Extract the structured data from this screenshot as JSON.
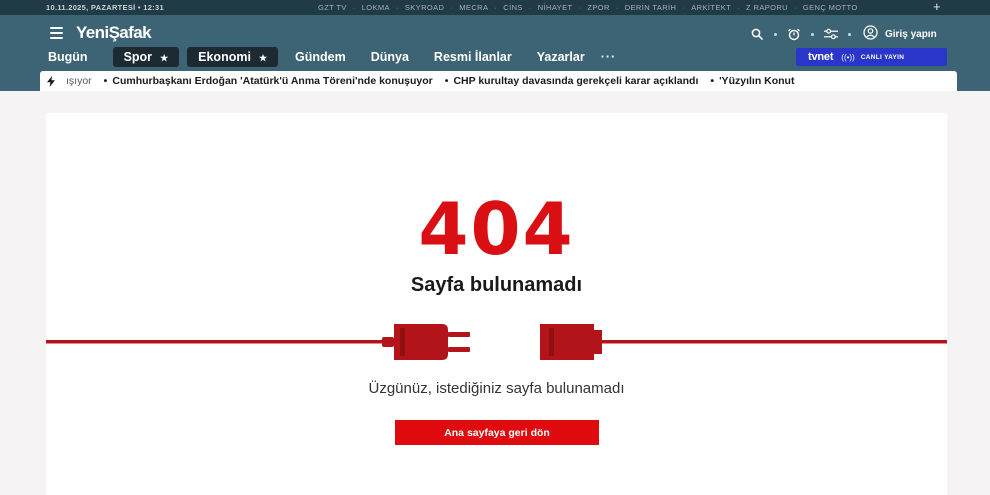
{
  "topbar": {
    "date": "10.11.2025, PAZARTESİ  •  12:31",
    "links": [
      "GZT TV",
      "LOKMA",
      "SKYROAD",
      "MECRA",
      "CİNS",
      "NİHAYET",
      "ZPOR",
      "DERİN TARİH",
      "ARKİTEKT",
      "Z RAPORU",
      "GENÇ MOTTO"
    ],
    "plus": "+"
  },
  "header": {
    "logo": "YeniŞafak",
    "nav": [
      {
        "label": "Bugün",
        "style": "plain"
      },
      {
        "label": "Spor",
        "style": "pill",
        "star": "★"
      },
      {
        "label": "Ekonomi",
        "style": "pill",
        "star": "★"
      },
      {
        "label": "Gündem",
        "style": "plain"
      },
      {
        "label": "Dünya",
        "style": "plain"
      },
      {
        "label": "Resmi İlanlar",
        "style": "plain"
      },
      {
        "label": "Yazarlar",
        "style": "plain"
      }
    ],
    "more": "···",
    "login_label": "Giriş yapın",
    "tvnet": {
      "brand": "tvnet",
      "live_icon": "((•))",
      "live_label": "CANLI YAYIN"
    },
    "icons": [
      "search-icon",
      "alarm-icon",
      "settings-sliders-icon",
      "user-icon",
      "menu-icon",
      "bolt-icon"
    ]
  },
  "ticker": {
    "items": [
      "ışıyor",
      "Cumhurbaşkanı Erdoğan 'Atatürk'ü Anma Töreni'nde konuşuyor",
      "CHP kurultay davasında gerekçeli karar açıklandı",
      "'Yüzyılın Konut"
    ],
    "bullet": "•"
  },
  "error": {
    "code": "404",
    "title": "Sayfa bulunamadı",
    "message": "Üzgünüz, istediğiniz sayfa bulunamadı",
    "button": "Ana sayfaya geri dön"
  },
  "colors": {
    "header_bg": "#3c6474",
    "topbar_bg": "#203a46",
    "accent_red": "#d90f13",
    "plug_red": "#b3141a",
    "tvnet_blue": "#2936c9"
  }
}
